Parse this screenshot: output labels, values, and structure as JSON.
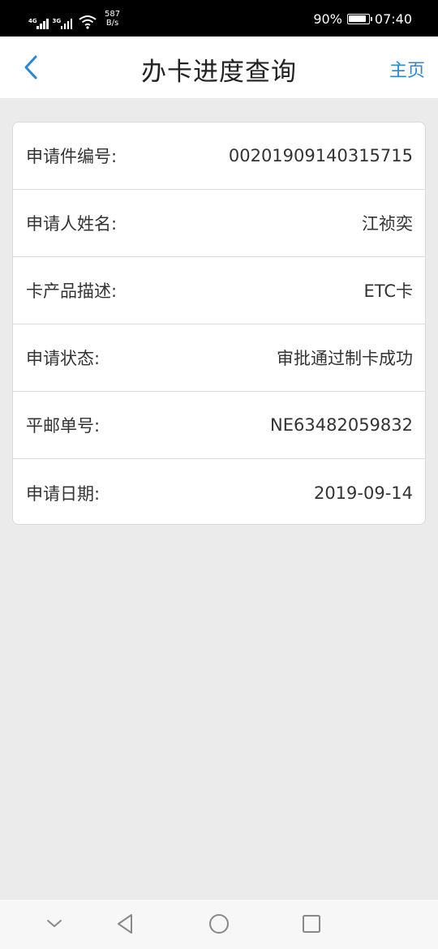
{
  "status_bar": {
    "network1": "4G",
    "network2": "3G",
    "speed_value": "587",
    "speed_unit": "B/s",
    "battery": "90%",
    "time": "07:40"
  },
  "header": {
    "title": "办卡进度查询",
    "home_label": "主页"
  },
  "info": {
    "rows": [
      {
        "label": "申请件编号:",
        "value": "00201909140315715"
      },
      {
        "label": "申请人姓名:",
        "value": "江祯奕"
      },
      {
        "label": "卡产品描述:",
        "value": "ETC卡"
      },
      {
        "label": "申请状态:",
        "value": "审批通过制卡成功"
      },
      {
        "label": "平邮单号:",
        "value": "NE63482059832"
      },
      {
        "label": "申请日期:",
        "value": "2019-09-14"
      }
    ]
  },
  "colors": {
    "accent": "#2a87d6",
    "background": "#ebebeb"
  }
}
